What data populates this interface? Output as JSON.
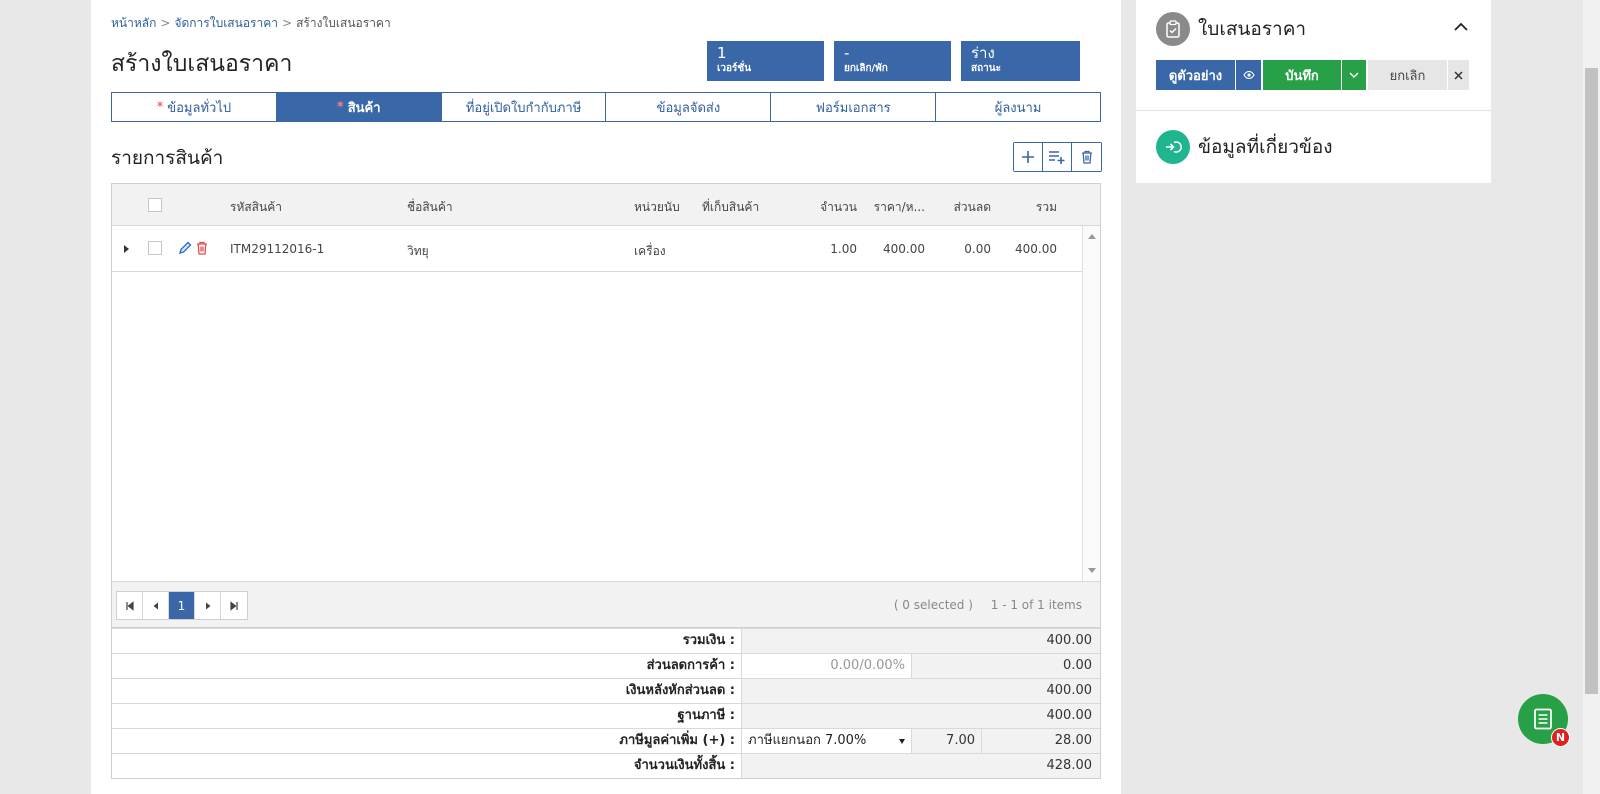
{
  "breadcrumb": {
    "items": [
      "หน้าหลัก",
      "จัดการใบเสนอราคา",
      "สร้างใบเสนอราคา"
    ]
  },
  "page": {
    "title": "สร้างใบเสนอราคา"
  },
  "stats": [
    {
      "value": "1",
      "label": "เวอร์ชั่น"
    },
    {
      "value": "-",
      "label": "ยกเลิก/พัก"
    },
    {
      "value": "ร่าง",
      "label": "สถานะ"
    }
  ],
  "tabs": [
    {
      "label": "ข้อมูลทั่วไป",
      "required": "*"
    },
    {
      "label": "สินค้า",
      "required": "*"
    },
    {
      "label": "ที่อยู่เปิดใบกำกับภาษี"
    },
    {
      "label": "ข้อมูลจัดส่ง"
    },
    {
      "label": "ฟอร์มเอกสาร"
    },
    {
      "label": "ผู้ลงนาม"
    }
  ],
  "section": {
    "title": "รายการสินค้า"
  },
  "grid": {
    "columns": [
      "รหัสสินค้า",
      "ชื่อสินค้า",
      "หน่วยนับ",
      "ที่เก็บสินค้า",
      "จำนวน",
      "ราคา/ห...",
      "ส่วนลด",
      "รวม"
    ],
    "rows": [
      {
        "code": "ITM29112016-1",
        "name": "วิทยุ",
        "unit": "เครื่อง",
        "warehouse": "",
        "qty": "1.00",
        "price": "400.00",
        "discount": "0.00",
        "total": "400.00"
      }
    ],
    "pager": {
      "current_page": "1",
      "selected_text": "( 0 selected )",
      "items_text": "1 - 1 of 1 items"
    }
  },
  "totals": {
    "subtotal": {
      "label": "รวมเงิน :",
      "value": "400.00"
    },
    "trade_discount": {
      "label": "ส่วนลดการค้า :",
      "input": "0.00/0.00%",
      "value": "0.00"
    },
    "after_discount": {
      "label": "เงินหลังหักส่วนลด :",
      "value": "400.00"
    },
    "tax_base": {
      "label": "ฐานภาษี :",
      "value": "400.00"
    },
    "vat": {
      "label": "ภาษีมูลค่าเพิ่ม (+) :",
      "option": "ภาษีแยกนอก 7.00%",
      "rate": "7.00",
      "value": "28.00"
    },
    "grand_total": {
      "label": "จำนวนเงินทั้งสิ้น :",
      "value": "428.00"
    }
  },
  "side_panel": {
    "title": "ใบเสนอราคา",
    "preview_label": "ดูตัวอย่าง",
    "save_label": "บันทึก",
    "cancel_label": "ยกเลิก",
    "related_title": "ข้อมูลที่เกี่ยวข้อง"
  },
  "fab": {
    "badge": "N"
  },
  "colors": {
    "primary": "#3967a8",
    "success": "#27a047",
    "danger": "#e02020",
    "required": "#e03c3c"
  }
}
